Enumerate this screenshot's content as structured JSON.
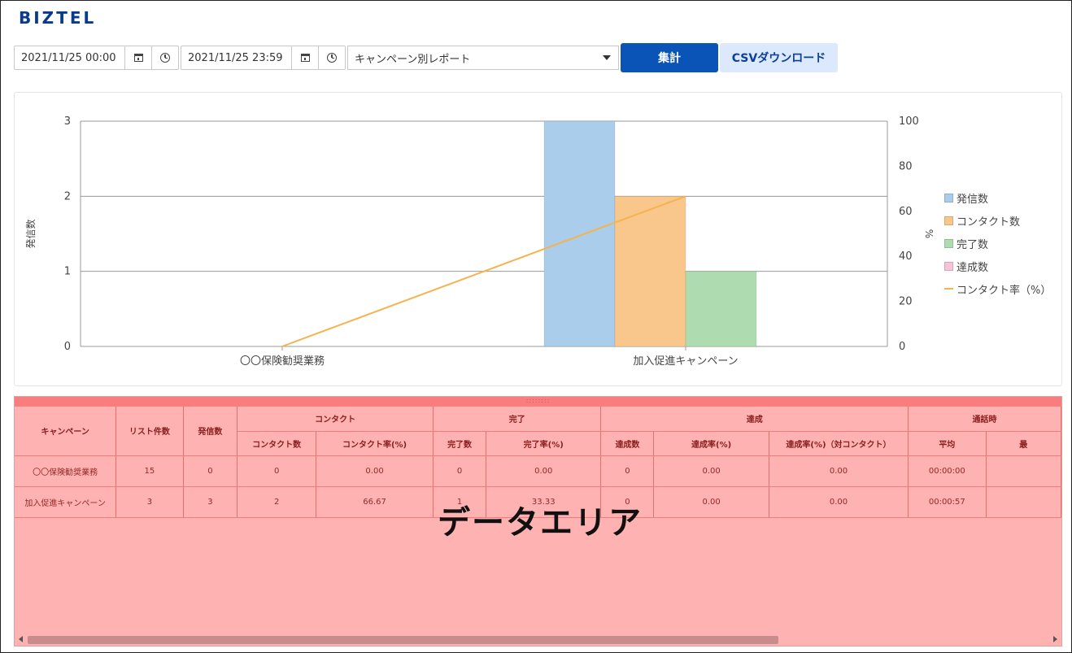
{
  "app": {
    "logo": "BIZTEL"
  },
  "toolbar": {
    "start_datetime": "2021/11/25 00:00",
    "end_datetime": "2021/11/25 23:59",
    "report_type": "キャンペーン別レポート",
    "aggregate_button": "集計",
    "csv_button": "CSVダウンロード"
  },
  "chart_data": {
    "type": "bar",
    "categories": [
      "〇〇保険勧奨業務",
      "加入促進キャンペーン"
    ],
    "series": [
      {
        "name": "発信数",
        "values": [
          0,
          3
        ],
        "color": "#a9cdea",
        "axis": "left"
      },
      {
        "name": "コンタクト数",
        "values": [
          0,
          2
        ],
        "color": "#f9c78b",
        "axis": "left"
      },
      {
        "name": "完了数",
        "values": [
          0,
          1
        ],
        "color": "#aedcb0",
        "axis": "left"
      },
      {
        "name": "達成数",
        "values": [
          0,
          0
        ],
        "color": "#f8c2d8",
        "axis": "left"
      },
      {
        "name": "コンタクト率（%）",
        "values": [
          0,
          66.67
        ],
        "color": "#f5b350",
        "axis": "right",
        "type": "line"
      }
    ],
    "ylabel": "発信数",
    "ylabel_right": "%",
    "ylim": [
      0,
      3
    ],
    "yticks": [
      0,
      1,
      2,
      3
    ],
    "ylim_right": [
      0,
      100
    ],
    "yticks_right": [
      0,
      20,
      40,
      60,
      80,
      100
    ],
    "grid": true,
    "legend": "right"
  },
  "table": {
    "headers_top": [
      {
        "label": "キャンペーン",
        "rowspan": 2
      },
      {
        "label": "リスト件数",
        "rowspan": 2
      },
      {
        "label": "発信数",
        "rowspan": 2
      },
      {
        "label": "コンタクト",
        "colspan": 2
      },
      {
        "label": "完了",
        "colspan": 2
      },
      {
        "label": "達成",
        "colspan": 3
      },
      {
        "label": "通話時",
        "colspan": 2
      }
    ],
    "headers_sub": [
      "コンタクト数",
      "コンタクト率(%)",
      "完了数",
      "完了率(%)",
      "達成数",
      "達成率(%)",
      "達成率(%)（対コンタクト）",
      "平均",
      "最"
    ],
    "rows": [
      [
        "〇〇保険勧奨業務",
        "15",
        "0",
        "0",
        "0.00",
        "0",
        "0.00",
        "0",
        "0.00",
        "0.00",
        "00:00:00",
        ""
      ],
      [
        "加入促進キャンペーン",
        "3",
        "3",
        "2",
        "66.67",
        "1",
        "33.33",
        "0",
        "0.00",
        "0.00",
        "00:00:57",
        ""
      ]
    ],
    "overlay_label": "データエリア",
    "grip": "::::::::"
  },
  "colors": {
    "accent": "#0a54b8",
    "overlay": "#ff0000"
  }
}
